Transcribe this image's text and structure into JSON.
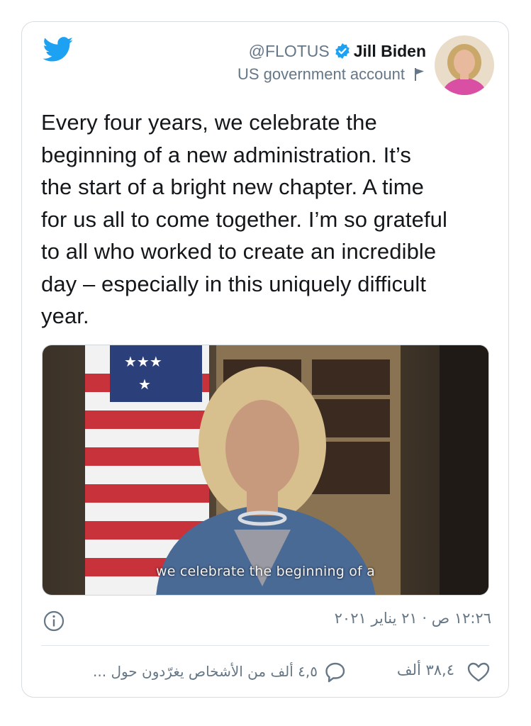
{
  "tweet": {
    "handle": "@FLOTUS",
    "display_name": "Jill Biden",
    "account_label": "US government account",
    "text": "Every four years, we celebrate the\nbeginning of a new administration.  It’s\nthe start of a bright new chapter. A time\nfor us all to come together. I’m so grateful\nto all who worked to create an incredible\nday – especially in this uniquely difficult\nyear.",
    "video_caption": "we celebrate the beginning of a",
    "timestamp": "١٢:٢٦ ص · ٢١ يناير ٢٠٢١",
    "likes": "٣٨,٤ ألف",
    "talking": "٤,٥ ألف من الأشخاص يغرّدون حول ..."
  },
  "colors": {
    "accent": "#1da1f2",
    "secondary_text": "#657786",
    "border": "#d7dde2"
  },
  "icons": [
    "twitter-bird-icon",
    "verified-badge-icon",
    "report-flag-icon",
    "info-icon",
    "reply-icon",
    "like-heart-icon"
  ]
}
